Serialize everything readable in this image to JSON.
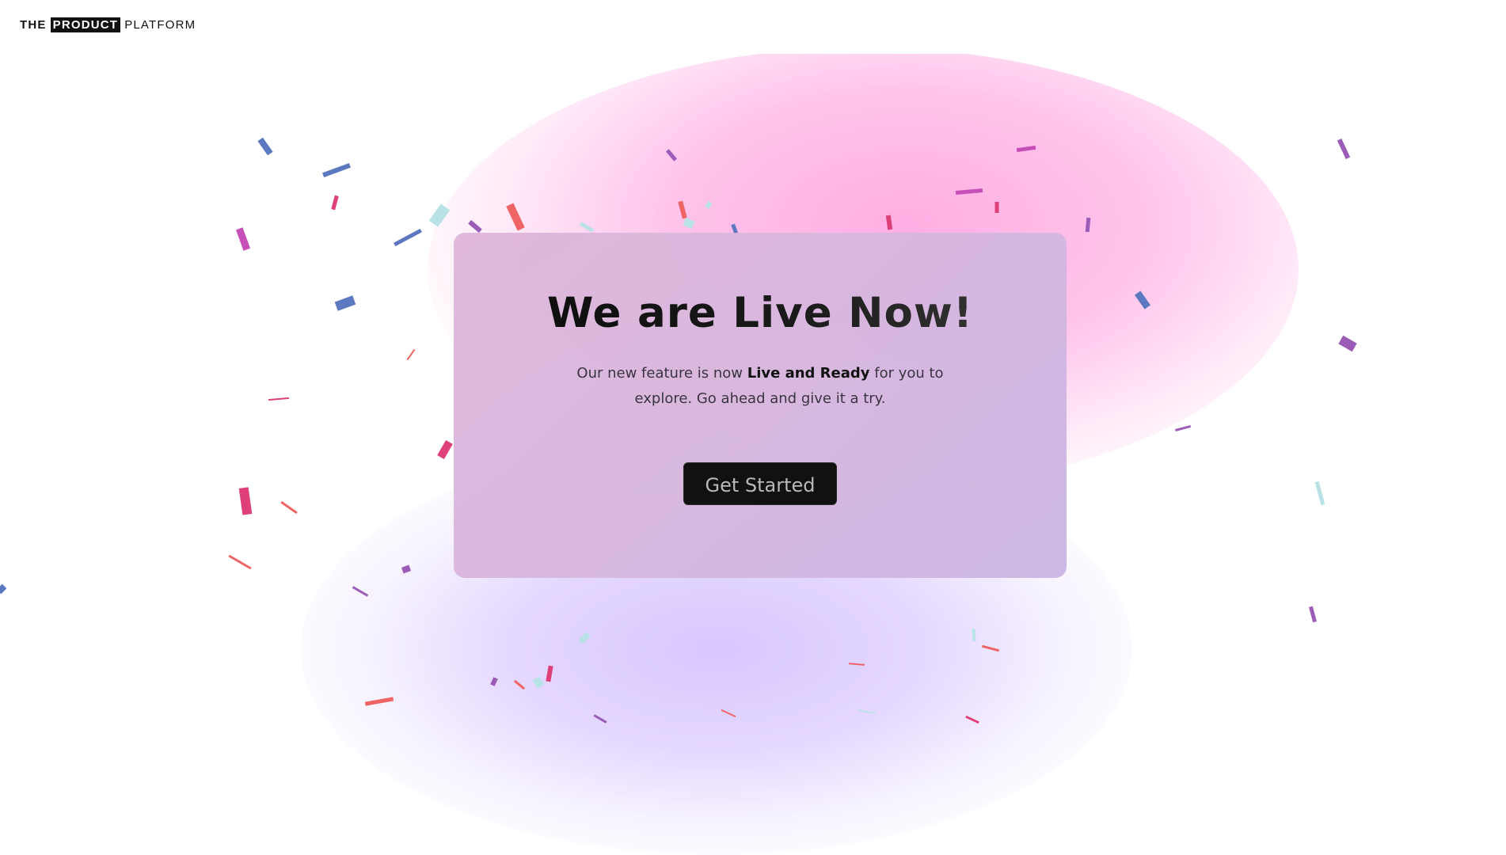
{
  "brand": {
    "prefix": "THE",
    "highlight": "PRODUCT",
    "suffix": "PLATFORM"
  },
  "hero": {
    "title": "We are Live Now!",
    "subtitle_before": "Our new feature is now ",
    "subtitle_bold": "Live and Ready",
    "subtitle_after": " for you to explore. Go ahead and give it a try.",
    "cta_label": "Get Started"
  },
  "colors": {
    "background": "#ffffff",
    "glow_pink": "#ffb6e6",
    "glow_purple": "#d8c8ff",
    "card": "#d8b8dc",
    "button": "#111111",
    "button_text": "#b9b9b9",
    "confetti": [
      "#5b78c0",
      "#e0407a",
      "#ef6464",
      "#9b5cb8",
      "#b9e2e6",
      "#c74fb8"
    ]
  }
}
